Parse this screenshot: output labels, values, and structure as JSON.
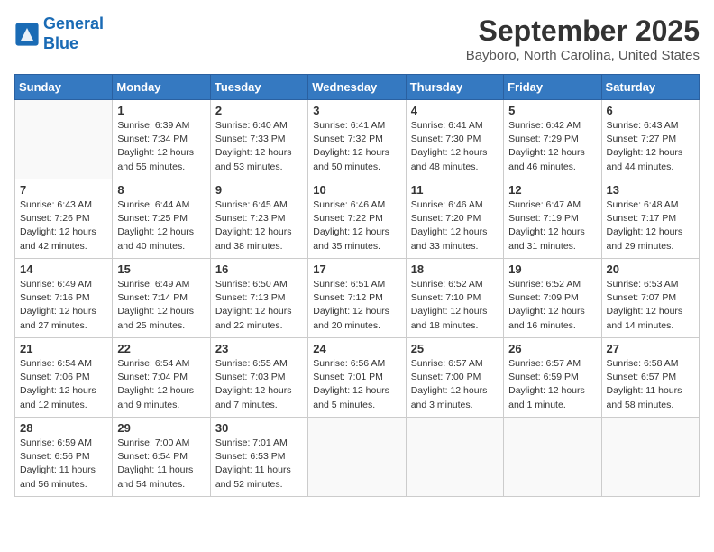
{
  "header": {
    "logo_line1": "General",
    "logo_line2": "Blue",
    "month": "September 2025",
    "location": "Bayboro, North Carolina, United States"
  },
  "weekdays": [
    "Sunday",
    "Monday",
    "Tuesday",
    "Wednesday",
    "Thursday",
    "Friday",
    "Saturday"
  ],
  "weeks": [
    [
      {
        "day": "",
        "info": ""
      },
      {
        "day": "1",
        "info": "Sunrise: 6:39 AM\nSunset: 7:34 PM\nDaylight: 12 hours\nand 55 minutes."
      },
      {
        "day": "2",
        "info": "Sunrise: 6:40 AM\nSunset: 7:33 PM\nDaylight: 12 hours\nand 53 minutes."
      },
      {
        "day": "3",
        "info": "Sunrise: 6:41 AM\nSunset: 7:32 PM\nDaylight: 12 hours\nand 50 minutes."
      },
      {
        "day": "4",
        "info": "Sunrise: 6:41 AM\nSunset: 7:30 PM\nDaylight: 12 hours\nand 48 minutes."
      },
      {
        "day": "5",
        "info": "Sunrise: 6:42 AM\nSunset: 7:29 PM\nDaylight: 12 hours\nand 46 minutes."
      },
      {
        "day": "6",
        "info": "Sunrise: 6:43 AM\nSunset: 7:27 PM\nDaylight: 12 hours\nand 44 minutes."
      }
    ],
    [
      {
        "day": "7",
        "info": "Sunrise: 6:43 AM\nSunset: 7:26 PM\nDaylight: 12 hours\nand 42 minutes."
      },
      {
        "day": "8",
        "info": "Sunrise: 6:44 AM\nSunset: 7:25 PM\nDaylight: 12 hours\nand 40 minutes."
      },
      {
        "day": "9",
        "info": "Sunrise: 6:45 AM\nSunset: 7:23 PM\nDaylight: 12 hours\nand 38 minutes."
      },
      {
        "day": "10",
        "info": "Sunrise: 6:46 AM\nSunset: 7:22 PM\nDaylight: 12 hours\nand 35 minutes."
      },
      {
        "day": "11",
        "info": "Sunrise: 6:46 AM\nSunset: 7:20 PM\nDaylight: 12 hours\nand 33 minutes."
      },
      {
        "day": "12",
        "info": "Sunrise: 6:47 AM\nSunset: 7:19 PM\nDaylight: 12 hours\nand 31 minutes."
      },
      {
        "day": "13",
        "info": "Sunrise: 6:48 AM\nSunset: 7:17 PM\nDaylight: 12 hours\nand 29 minutes."
      }
    ],
    [
      {
        "day": "14",
        "info": "Sunrise: 6:49 AM\nSunset: 7:16 PM\nDaylight: 12 hours\nand 27 minutes."
      },
      {
        "day": "15",
        "info": "Sunrise: 6:49 AM\nSunset: 7:14 PM\nDaylight: 12 hours\nand 25 minutes."
      },
      {
        "day": "16",
        "info": "Sunrise: 6:50 AM\nSunset: 7:13 PM\nDaylight: 12 hours\nand 22 minutes."
      },
      {
        "day": "17",
        "info": "Sunrise: 6:51 AM\nSunset: 7:12 PM\nDaylight: 12 hours\nand 20 minutes."
      },
      {
        "day": "18",
        "info": "Sunrise: 6:52 AM\nSunset: 7:10 PM\nDaylight: 12 hours\nand 18 minutes."
      },
      {
        "day": "19",
        "info": "Sunrise: 6:52 AM\nSunset: 7:09 PM\nDaylight: 12 hours\nand 16 minutes."
      },
      {
        "day": "20",
        "info": "Sunrise: 6:53 AM\nSunset: 7:07 PM\nDaylight: 12 hours\nand 14 minutes."
      }
    ],
    [
      {
        "day": "21",
        "info": "Sunrise: 6:54 AM\nSunset: 7:06 PM\nDaylight: 12 hours\nand 12 minutes."
      },
      {
        "day": "22",
        "info": "Sunrise: 6:54 AM\nSunset: 7:04 PM\nDaylight: 12 hours\nand 9 minutes."
      },
      {
        "day": "23",
        "info": "Sunrise: 6:55 AM\nSunset: 7:03 PM\nDaylight: 12 hours\nand 7 minutes."
      },
      {
        "day": "24",
        "info": "Sunrise: 6:56 AM\nSunset: 7:01 PM\nDaylight: 12 hours\nand 5 minutes."
      },
      {
        "day": "25",
        "info": "Sunrise: 6:57 AM\nSunset: 7:00 PM\nDaylight: 12 hours\nand 3 minutes."
      },
      {
        "day": "26",
        "info": "Sunrise: 6:57 AM\nSunset: 6:59 PM\nDaylight: 12 hours\nand 1 minute."
      },
      {
        "day": "27",
        "info": "Sunrise: 6:58 AM\nSunset: 6:57 PM\nDaylight: 11 hours\nand 58 minutes."
      }
    ],
    [
      {
        "day": "28",
        "info": "Sunrise: 6:59 AM\nSunset: 6:56 PM\nDaylight: 11 hours\nand 56 minutes."
      },
      {
        "day": "29",
        "info": "Sunrise: 7:00 AM\nSunset: 6:54 PM\nDaylight: 11 hours\nand 54 minutes."
      },
      {
        "day": "30",
        "info": "Sunrise: 7:01 AM\nSunset: 6:53 PM\nDaylight: 11 hours\nand 52 minutes."
      },
      {
        "day": "",
        "info": ""
      },
      {
        "day": "",
        "info": ""
      },
      {
        "day": "",
        "info": ""
      },
      {
        "day": "",
        "info": ""
      }
    ]
  ]
}
